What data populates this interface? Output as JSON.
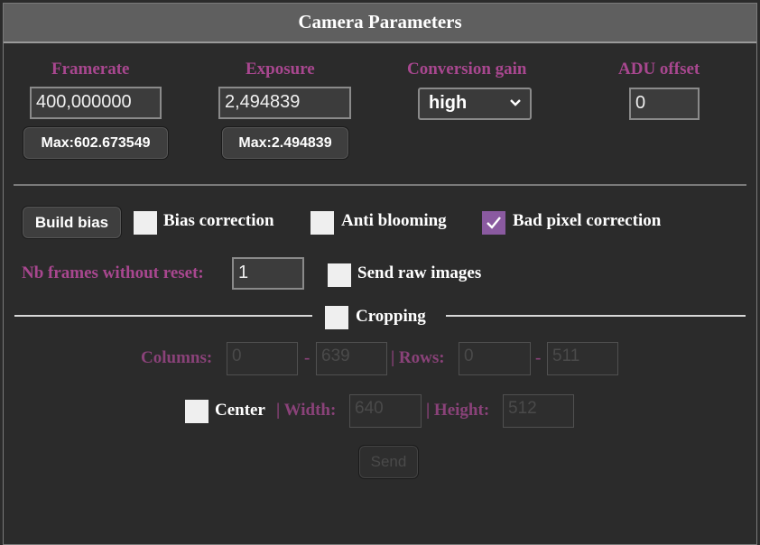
{
  "title": "Camera Parameters",
  "params": {
    "framerate": {
      "label": "Framerate",
      "value": "400,000000",
      "max_label": "Max:602.673549"
    },
    "exposure": {
      "label": "Exposure",
      "value": "2,494839",
      "max_label": "Max:2.494839"
    },
    "conversion_gain": {
      "label": "Conversion gain",
      "selected": "high"
    },
    "adu_offset": {
      "label": "ADU offset",
      "value": "0"
    }
  },
  "options": {
    "build_bias_label": "Build bias",
    "bias_correction_label": "Bias correction",
    "bias_correction_checked": false,
    "anti_blooming_label": "Anti blooming",
    "anti_blooming_checked": false,
    "bad_pixel_label": "Bad pixel correction",
    "bad_pixel_checked": true,
    "nb_frames_label": "Nb frames without reset:",
    "nb_frames_value": "1",
    "send_raw_label": "Send raw images",
    "send_raw_checked": false
  },
  "cropping": {
    "label": "Cropping",
    "checked": false,
    "columns_label": "Columns:",
    "col_from": "0",
    "col_sep": "-",
    "col_to": "639",
    "rows_label": "| Rows:",
    "row_from": "0",
    "row_sep": "-",
    "row_to": "511",
    "center_label": "Center",
    "center_checked": false,
    "width_label": "| Width:",
    "width_value": "640",
    "height_label": "| Height:",
    "height_value": "512",
    "send_label": "Send"
  },
  "colors": {
    "accent": "#a8478f",
    "checkbox_checked": "#8a5aa0",
    "title_bar": "#5f5f5f",
    "background": "#2b2b2b"
  }
}
